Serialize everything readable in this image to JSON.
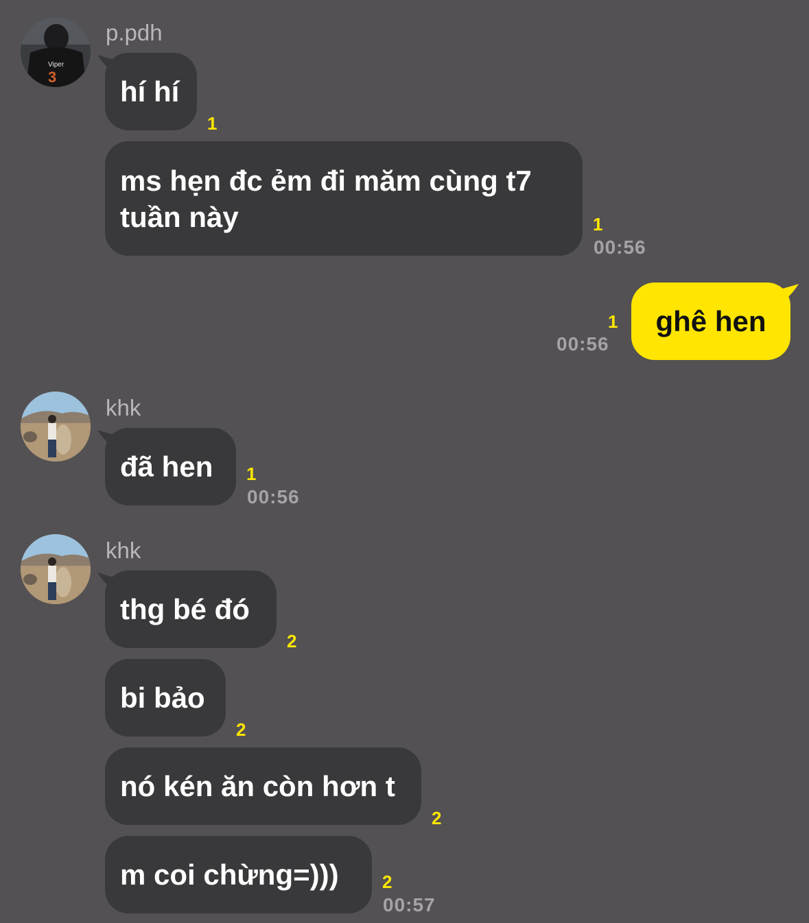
{
  "messages": {
    "pdh": {
      "sender": "p.pdh",
      "avatar_text": "Viper",
      "avatar_number": "3",
      "m1": "hí hí",
      "m1_count": "1",
      "m2": "ms hẹn đc ẻm đi măm cùng t7 tuần này",
      "m2_count": "1",
      "m2_time": "00:56"
    },
    "mine": {
      "text": "ghê hen",
      "count": "1",
      "time": "00:56"
    },
    "khk1": {
      "sender": "khk",
      "m1": "đã hen",
      "m1_count": "1",
      "m1_time": "00:56"
    },
    "khk2": {
      "sender": "khk",
      "m1": "thg bé đó",
      "m1_count": "2",
      "m2": "bi bảo",
      "m2_count": "2",
      "m3": "nó kén ăn còn hơn t",
      "m3_count": "2",
      "m4": "m coi chừng=)))",
      "m4_count": "2",
      "m4_time": "00:57"
    }
  },
  "colors": {
    "background": "#535153",
    "incoming_bubble": "#39383a",
    "outgoing_bubble": "#ffe500",
    "unread_count": "#ffe600",
    "timestamp": "#a5a3a5"
  }
}
